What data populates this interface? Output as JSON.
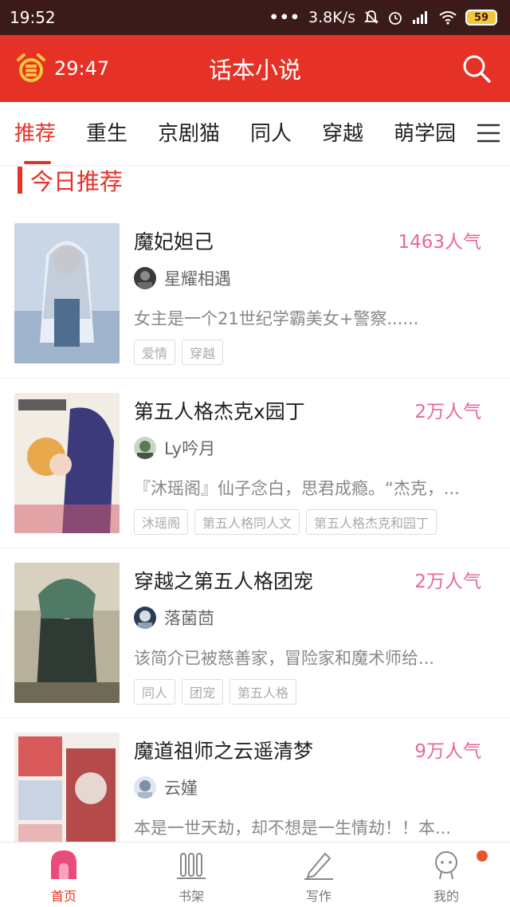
{
  "status_bar": {
    "time": "19:52",
    "dots": "•••",
    "speed": "3.8K/s",
    "battery": "59"
  },
  "header": {
    "timer": "29:47",
    "title": "话本小说"
  },
  "tabs": [
    "推荐",
    "重生",
    "京剧猫",
    "同人",
    "穿越",
    "萌学园"
  ],
  "section": {
    "title": "今日推荐"
  },
  "books": [
    {
      "title": "魔妃妲己",
      "popularity": "1463人气",
      "author": "星耀相遇",
      "description": "女主是一个21世纪学霸美女+警察......",
      "tags": [
        "爱情",
        "穿越"
      ]
    },
    {
      "title": "第五人格杰克x园丁",
      "popularity": "2万人气",
      "author": "Ly吟月",
      "description": "『沐瑶阁』仙子念白，思君成瘾。“杰克，...",
      "tags": [
        "沐瑶阁",
        "第五人格同人文",
        "第五人格杰克和园丁"
      ]
    },
    {
      "title": "穿越之第五人格团宠",
      "popularity": "2万人气",
      "author": "落菌茴",
      "description": "该简介已被慈善家，冒险家和魔术师给...",
      "tags": [
        "同人",
        "团宠",
        "第五人格"
      ]
    },
    {
      "title": "魔道祖师之云遥清梦",
      "popularity": "9万人气",
      "author": "云嫤",
      "description": "本是一世天劫，却不想是一生情劫！！本...",
      "tags": []
    }
  ],
  "bottom_nav": [
    {
      "label": "首页",
      "icon": "home-icon",
      "active": true
    },
    {
      "label": "书架",
      "icon": "bookshelf-icon",
      "active": false
    },
    {
      "label": "写作",
      "icon": "pencil-icon",
      "active": false
    },
    {
      "label": "我的",
      "icon": "profile-icon",
      "active": false
    }
  ],
  "colors": {
    "accent": "#e63226",
    "popularity": "#e8679c",
    "status_bar": "#3b1a1a"
  }
}
